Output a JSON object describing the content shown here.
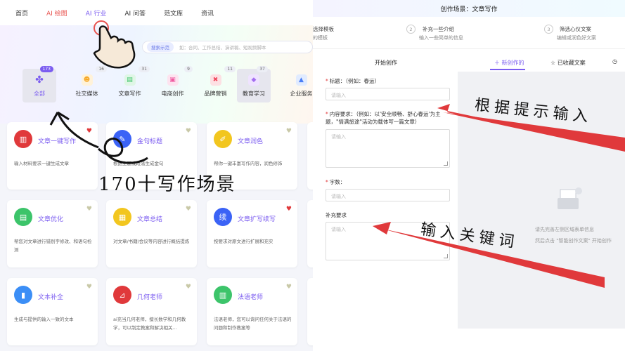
{
  "nav": {
    "items": [
      "首页",
      "AI 绘图",
      "AI 行业",
      "AI 问答",
      "范文库",
      "资讯"
    ]
  },
  "search": {
    "tag": "搜索示范",
    "placeholder": "如：合同、工作总结、演讲稿、短视频脚本"
  },
  "categories": [
    {
      "label": "全部",
      "count": "173",
      "icon": "grid-icon",
      "color": "#7b5cf0"
    },
    {
      "label": "社交媒体",
      "count": "16",
      "icon": "social-icon",
      "color": "#f6a623"
    },
    {
      "label": "文章写作",
      "count": "31",
      "icon": "doc-icon",
      "color": "#3cc46a"
    },
    {
      "label": "电商创作",
      "count": "9",
      "icon": "shop-icon",
      "color": "#ef5aa0"
    },
    {
      "label": "品牌营销",
      "count": "11",
      "icon": "brand-icon",
      "color": "#f0455a"
    },
    {
      "label": "教育学习",
      "count": "37",
      "icon": "education-icon",
      "color": "#a46ef0"
    },
    {
      "label": "企业服务",
      "count": "",
      "icon": "enterprise-icon",
      "color": "#4a7ef6"
    }
  ],
  "cards": [
    {
      "title": "文章一键写作",
      "desc": "输入材料要求一键生成文章",
      "color": "#e0393b",
      "icon": "book-icon",
      "fav": true
    },
    {
      "title": "金句标题",
      "desc": "根据主题或段落生成金句",
      "color": "#3b63f6",
      "icon": "pen-icon",
      "fav": false
    },
    {
      "title": "文章润色",
      "desc": "帮你一键丰富写作内容，润色修饰",
      "color": "#f2c61f",
      "icon": "edit-icon",
      "fav": false
    },
    {
      "title": "文章优化",
      "desc": "帮您对文章进行错别字修改、和语句检测",
      "color": "#3cc46a",
      "icon": "note-icon",
      "fav": false
    },
    {
      "title": "文章总结",
      "desc": "对文章/书籍/会议等内容进行概括提炼",
      "color": "#f2c61f",
      "icon": "summary-icon",
      "fav": false
    },
    {
      "title": "文章扩写续写",
      "desc": "按要求对原文进行扩展和充实",
      "color": "#3b63f6",
      "icon": "expand-icon",
      "fav": true
    },
    {
      "title": "文本补全",
      "desc": "生成与提供的输入一致的文本",
      "color": "#3b8ef6",
      "icon": "text-icon",
      "fav": false
    },
    {
      "title": "几何老师",
      "desc": "ai充当几何老师，擅长数学和几何教学，可以制定教案和解决相关...",
      "color": "#e0393b",
      "icon": "geometry-icon",
      "fav": false
    },
    {
      "title": "法语老师",
      "desc": "法语老师，您可以询问任何关于法语的问题和制作教案等",
      "color": "#3cc46a",
      "icon": "french-icon",
      "fav": false
    }
  ],
  "overlay": {
    "left": "170十写作场景",
    "right_top": "根据提示输入",
    "right_bottom": "输入关键词"
  },
  "right": {
    "header": "创作场景：文章写作",
    "steps": [
      {
        "num": "",
        "title": "选择模板",
        "sub": "的模板"
      },
      {
        "num": "2",
        "title": "补充一些介绍",
        "sub": "输入一些简单的信息"
      },
      {
        "num": "3",
        "title": "筛选心仪文案",
        "sub": "编辑或润色好文案"
      }
    ],
    "tabs": {
      "start": "开始创作",
      "new": "新创作的",
      "saved": "已收藏文案"
    },
    "form": {
      "title_label": "标题：（例如：春运）",
      "title_ph": "请输入",
      "content_label": "内容要求：（例如：以'安全顺畅、舒心春运'为主题，\"情满旅途\"活动为载体写一篇文章）",
      "content_ph": "请输入",
      "count_label": "字数：",
      "count_ph": "请输入",
      "extra_label": "补充要求",
      "extra_ph": "请输入"
    },
    "preview": {
      "line1": "请先完善左侧区域表单信息",
      "line2": "然后点击 \"智能创作文案\" 开始创作"
    }
  }
}
